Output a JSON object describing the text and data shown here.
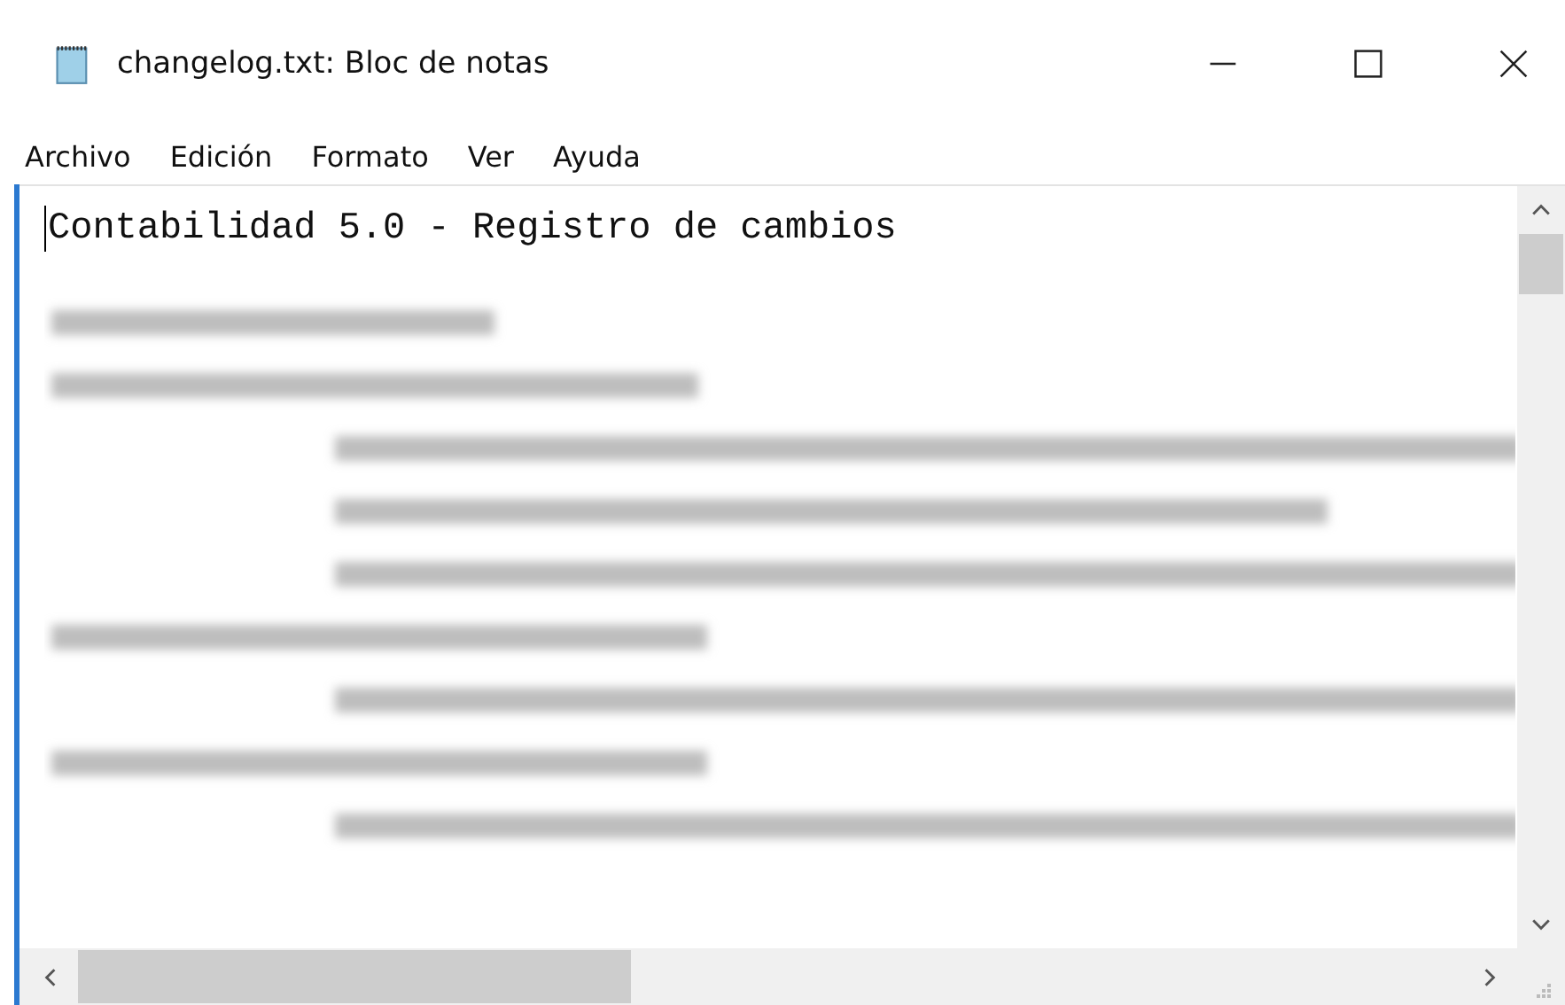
{
  "window": {
    "title": "changelog.txt: Bloc de notas",
    "controls": [
      {
        "kind": "minimize"
      },
      {
        "kind": "maximize"
      },
      {
        "kind": "close"
      }
    ]
  },
  "menu": [
    {
      "label": "Archivo"
    },
    {
      "label": "Edición"
    },
    {
      "label": "Formato"
    },
    {
      "label": "Ver"
    },
    {
      "label": "Ayuda"
    }
  ],
  "editor": {
    "first_line": "Contabilidad 5.0 - Registro de cambios",
    "blurred_lines": [
      {
        "kind": "heading"
      },
      {
        "kind": "heading"
      },
      {
        "kind": "item"
      },
      {
        "kind": "item"
      },
      {
        "kind": "item"
      },
      {
        "kind": "heading"
      },
      {
        "kind": "item"
      },
      {
        "kind": "heading"
      },
      {
        "kind": "item"
      }
    ]
  }
}
